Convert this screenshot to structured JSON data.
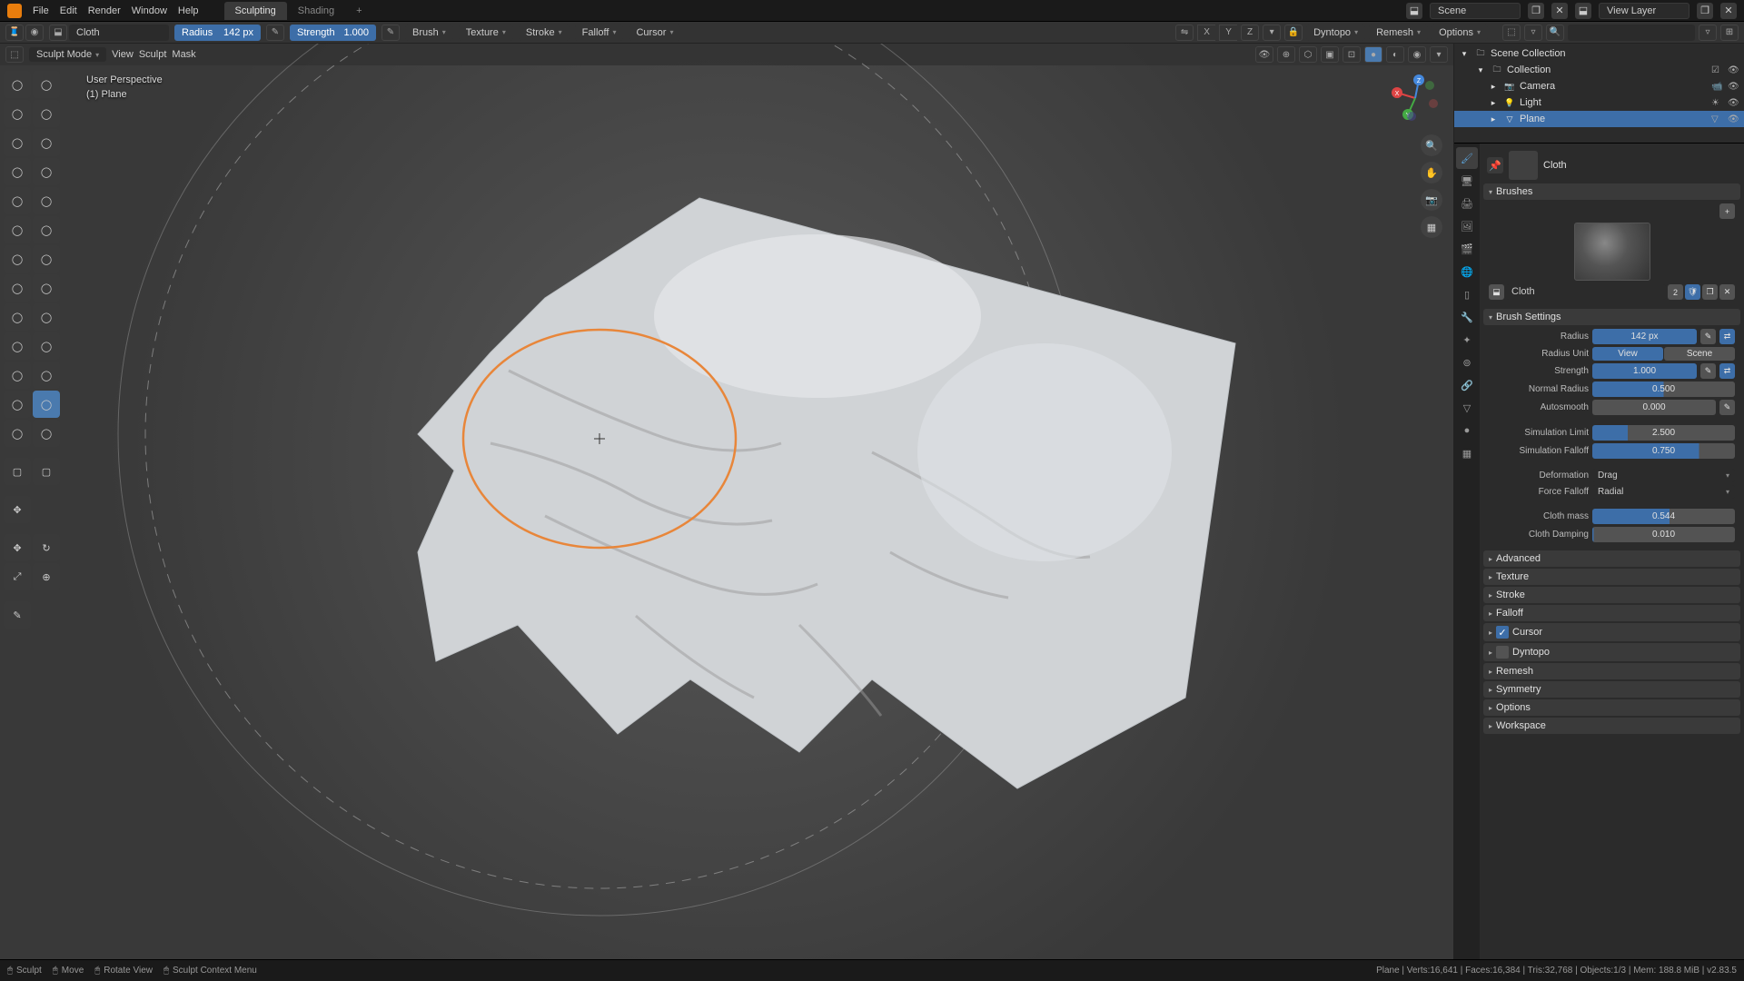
{
  "menu": {
    "file": "File",
    "edit": "Edit",
    "render": "Render",
    "window": "Window",
    "help": "Help"
  },
  "workspaces": {
    "sculpting": "Sculpting",
    "shading": "Shading",
    "add": "+"
  },
  "top_right": {
    "scene": "Scene",
    "view_layer": "View Layer"
  },
  "toolbar": {
    "brush_name": "Cloth",
    "radius_label": "Radius",
    "radius_value": "142 px",
    "strength_label": "Strength",
    "strength_value": "1.000",
    "brush": "Brush",
    "texture": "Texture",
    "stroke": "Stroke",
    "falloff": "Falloff",
    "cursor": "Cursor",
    "xyz": {
      "x": "X",
      "y": "Y",
      "z": "Z"
    },
    "dyntopo": "Dyntopo",
    "remesh": "Remesh",
    "options": "Options"
  },
  "viewport_header": {
    "mode": "Sculpt Mode",
    "view": "View",
    "sculpt": "Sculpt",
    "mask": "Mask"
  },
  "viewport_info": {
    "persp": "User Perspective",
    "object": "(1) Plane"
  },
  "outliner": {
    "scene_collection": "Scene Collection",
    "collection": "Collection",
    "camera": "Camera",
    "light": "Light",
    "plane": "Plane"
  },
  "properties": {
    "brush_name": "Cloth",
    "brushes": "Brushes",
    "brush_count": "2",
    "brush_settings": "Brush Settings",
    "radius": {
      "label": "Radius",
      "value": "142 px"
    },
    "radius_unit": {
      "label": "Radius Unit",
      "view": "View",
      "scene": "Scene"
    },
    "strength": {
      "label": "Strength",
      "value": "1.000"
    },
    "normal_radius": {
      "label": "Normal Radius",
      "value": "0.500"
    },
    "autosmooth": {
      "label": "Autosmooth",
      "value": "0.000"
    },
    "sim_limit": {
      "label": "Simulation Limit",
      "value": "2.500"
    },
    "sim_falloff": {
      "label": "Simulation Falloff",
      "value": "0.750"
    },
    "deformation": {
      "label": "Deformation",
      "value": "Drag"
    },
    "force_falloff": {
      "label": "Force Falloff",
      "value": "Radial"
    },
    "cloth_mass": {
      "label": "Cloth mass",
      "value": "0.544"
    },
    "cloth_damping": {
      "label": "Cloth Damping",
      "value": "0.010"
    },
    "panels": {
      "advanced": "Advanced",
      "texture": "Texture",
      "stroke": "Stroke",
      "falloff": "Falloff",
      "cursor": "Cursor",
      "dyntopo": "Dyntopo",
      "remesh": "Remesh",
      "symmetry": "Symmetry",
      "options": "Options",
      "workspace": "Workspace"
    }
  },
  "status": {
    "sculpt": "Sculpt",
    "move": "Move",
    "rotate": "Rotate View",
    "context": "Sculpt Context Menu",
    "stats": "Plane | Verts:16,641 | Faces:16,384 | Tris:32,768 | Objects:1/3 | Mem: 188.8 MiB | v2.83.5"
  }
}
